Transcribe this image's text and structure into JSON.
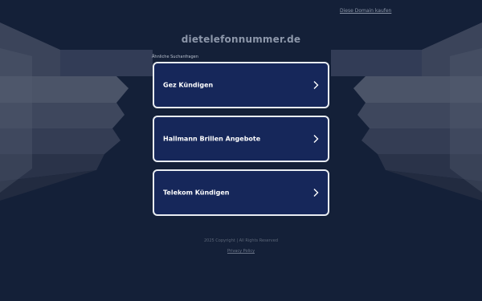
{
  "header": {
    "buy_domain_link": "Diese Domain kaufen"
  },
  "site": {
    "title": "dietelefonnummer.de"
  },
  "related": {
    "label": "Ähnliche Suchanfragen",
    "items": [
      {
        "label": "Gez Kündigen"
      },
      {
        "label": "Hallmann Brillen Angebote"
      },
      {
        "label": "Telekom Kündigen"
      }
    ]
  },
  "footer": {
    "copyright": "2025 Copyright | All Rights Reserved",
    "privacy_link": "Privacy Policy"
  },
  "colors": {
    "background": "#142038",
    "card_background": "#16275a",
    "card_border": "#e8ecf2",
    "title_text": "#8d97aa"
  },
  "icons": {
    "card_arrow": "chevron-right-icon"
  }
}
